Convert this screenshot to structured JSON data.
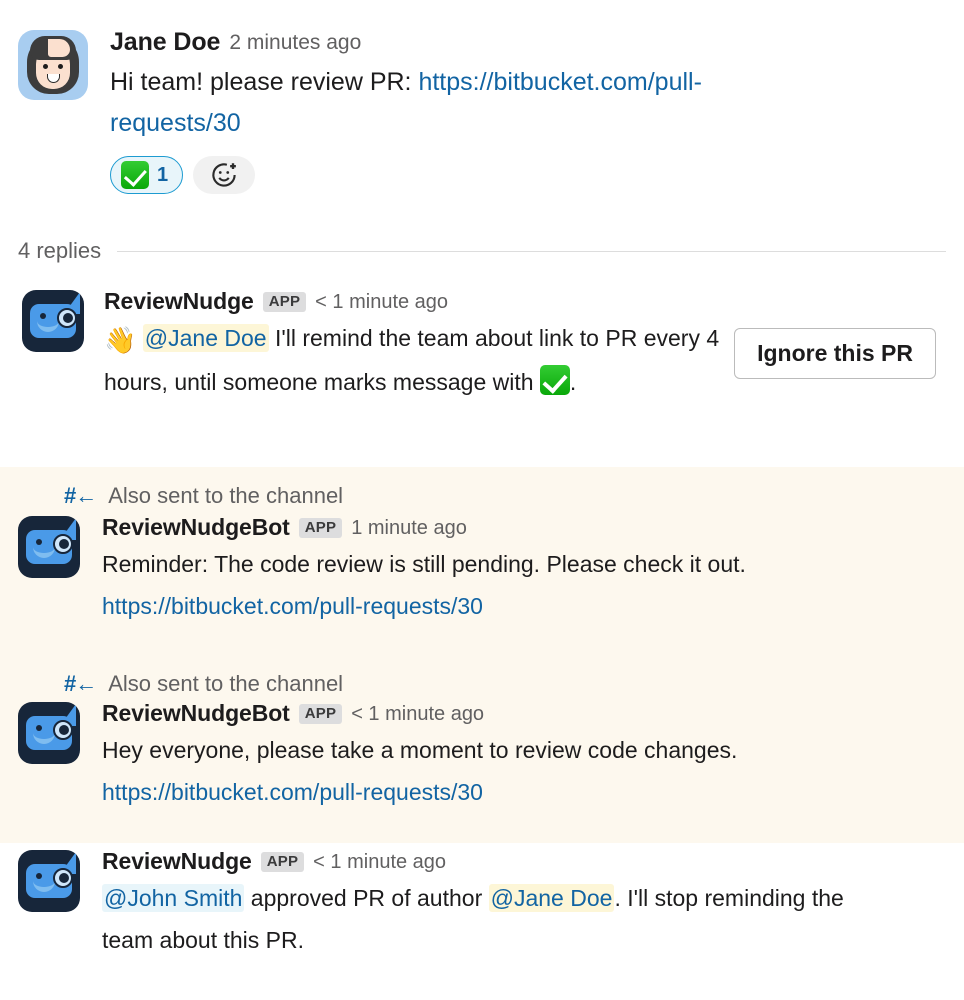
{
  "root_message": {
    "author": "Jane Doe",
    "timestamp": "2 minutes ago",
    "text_before_link": "Hi team! please review PR: ",
    "link": "https://bitbucket.com/pull-requests/30",
    "reaction": {
      "emoji_name": "white-check-mark",
      "count": "1"
    },
    "add_reaction_label": "add-reaction"
  },
  "thread": {
    "replies_label": "4 replies"
  },
  "broadcast_notice": {
    "icon_name": "channel-broadcast-icon",
    "label": "Also sent to the channel"
  },
  "replies": [
    {
      "author": "ReviewNudge",
      "badge": "APP",
      "timestamp": "< 1 minute ago",
      "emoji_name": "wave",
      "mention": "@Jane Doe",
      "text_part1": " I'll remind the team about link to PR every 4 hours, until someone marks message with ",
      "text_part2": ".",
      "action_button": "Ignore this PR"
    },
    {
      "author": "ReviewNudgeBot",
      "badge": "APP",
      "timestamp": "1 minute ago",
      "text": "Reminder: The code review is still pending. Please check it out. ",
      "link": "https://bitbucket.com/pull-requests/30"
    },
    {
      "author": "ReviewNudgeBot",
      "badge": "APP",
      "timestamp": "< 1 minute ago",
      "text": "Hey everyone, please take a moment to review code changes. ",
      "link": "https://bitbucket.com/pull-requests/30"
    },
    {
      "author": "ReviewNudge",
      "badge": "APP",
      "timestamp": "< 1 minute ago",
      "mention_approver": "@John Smith",
      "text_mid": " approved PR of author ",
      "mention_author": "@Jane Doe",
      "text_end": ". I'll stop reminding the team about this PR."
    }
  ],
  "colors": {
    "link": "#1264a3",
    "mention_highlight_yellow": "#fdf6d7",
    "mention_highlight_blue": "#e8f5fa",
    "broadcast_background": "#fdf8ee",
    "reaction_border": "#1d9bd1",
    "text": "#1d1c1d",
    "muted_text": "#616061"
  }
}
